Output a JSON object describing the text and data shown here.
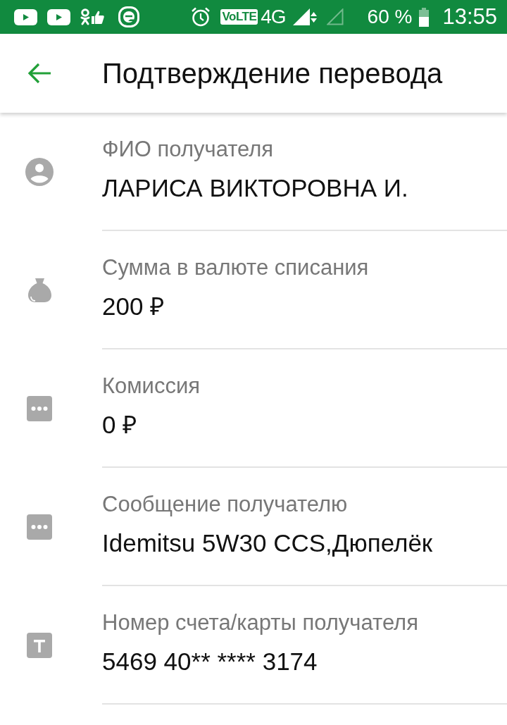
{
  "status_bar": {
    "volte": "VoLTE",
    "network": "4G",
    "battery": "60 %",
    "time": "13:55"
  },
  "app_bar": {
    "title": "Подтверждение перевода"
  },
  "fields": [
    {
      "kind": "person",
      "label": "ФИО получателя",
      "value": "ЛАРИСА ВИКТОРОВНА И."
    },
    {
      "kind": "money-bag",
      "label": "Сумма в валюте списания",
      "value": "200 ₽"
    },
    {
      "kind": "dots",
      "label": "Комиссия",
      "value": "0 ₽"
    },
    {
      "kind": "dots",
      "label": "Сообщение получателю",
      "value": "Idemitsu 5W30 CCS,Дюпелёк"
    },
    {
      "kind": "text",
      "label": "Номер счета/карты получателя",
      "value": "5469 40** **** 3174"
    }
  ]
}
